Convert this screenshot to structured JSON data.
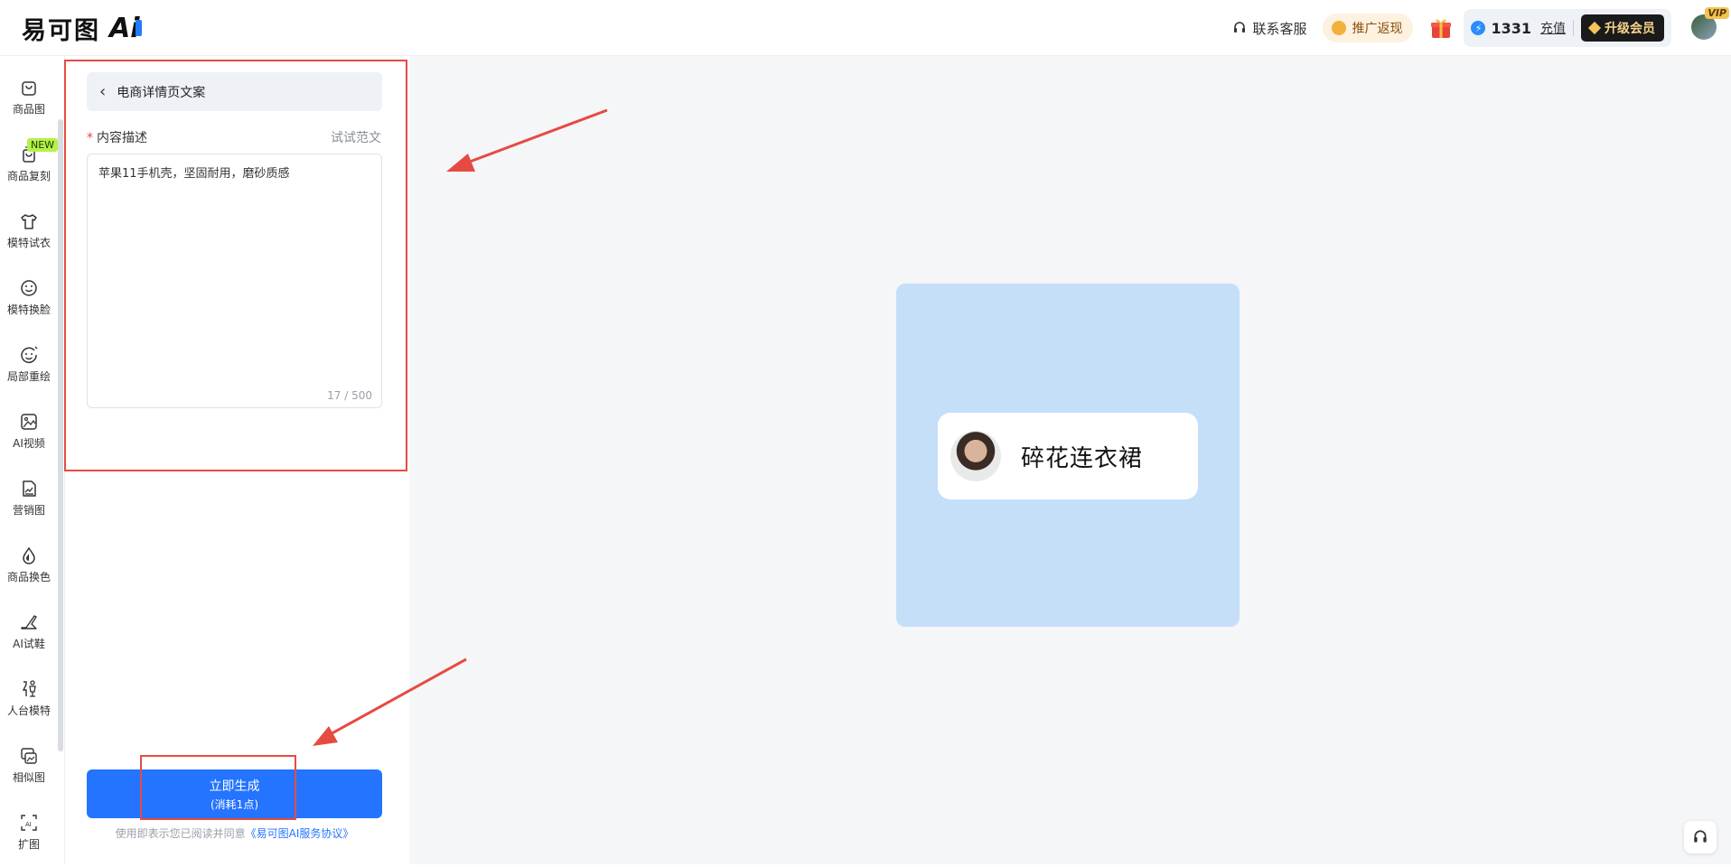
{
  "header": {
    "logo_text": "易可图",
    "logo_ai": "Ai",
    "service_label": "联系客服",
    "promo_label": "推广返现",
    "points": "1331",
    "recharge_label": "充值",
    "upgrade_label": "升级会员",
    "vip_badge": "VIP"
  },
  "sidebar": {
    "items": [
      {
        "label": "商品图",
        "icon": "bag-icon"
      },
      {
        "label": "商品复刻",
        "icon": "copy-bag-icon",
        "badge": "NEW"
      },
      {
        "label": "模特试衣",
        "icon": "shirt-icon"
      },
      {
        "label": "模特换脸",
        "icon": "face-icon"
      },
      {
        "label": "局部重绘",
        "icon": "face-edit-icon"
      },
      {
        "label": "AI视频",
        "icon": "video-icon"
      },
      {
        "label": "营销图",
        "icon": "chart-doc-icon"
      },
      {
        "label": "商品换色",
        "icon": "droplet-icon"
      },
      {
        "label": "AI试鞋",
        "icon": "shoe-icon"
      },
      {
        "label": "人台模特",
        "icon": "mannequin-icon"
      },
      {
        "label": "相似图",
        "icon": "images-icon"
      },
      {
        "label": "扩图",
        "icon": "expand-icon"
      }
    ]
  },
  "form": {
    "back_title": "电商详情页文案",
    "required_mark": "*",
    "field_label": "内容描述",
    "sample_link": "试试范文",
    "textarea_value": "苹果11手机壳，坚固耐用，磨砂质感",
    "counter": "17 / 500",
    "generate_label": "立即生成",
    "generate_sub": "(消耗1点)",
    "agreement_text": "使用即表示您已阅读并同意",
    "agreement_link": "《易可图AI服务协议》"
  },
  "preview": {
    "chip_text": "碎花连衣裙"
  },
  "colors": {
    "primary": "#2474ff",
    "annotation": "#e64b42",
    "preview_bg": "#c6dff8"
  }
}
